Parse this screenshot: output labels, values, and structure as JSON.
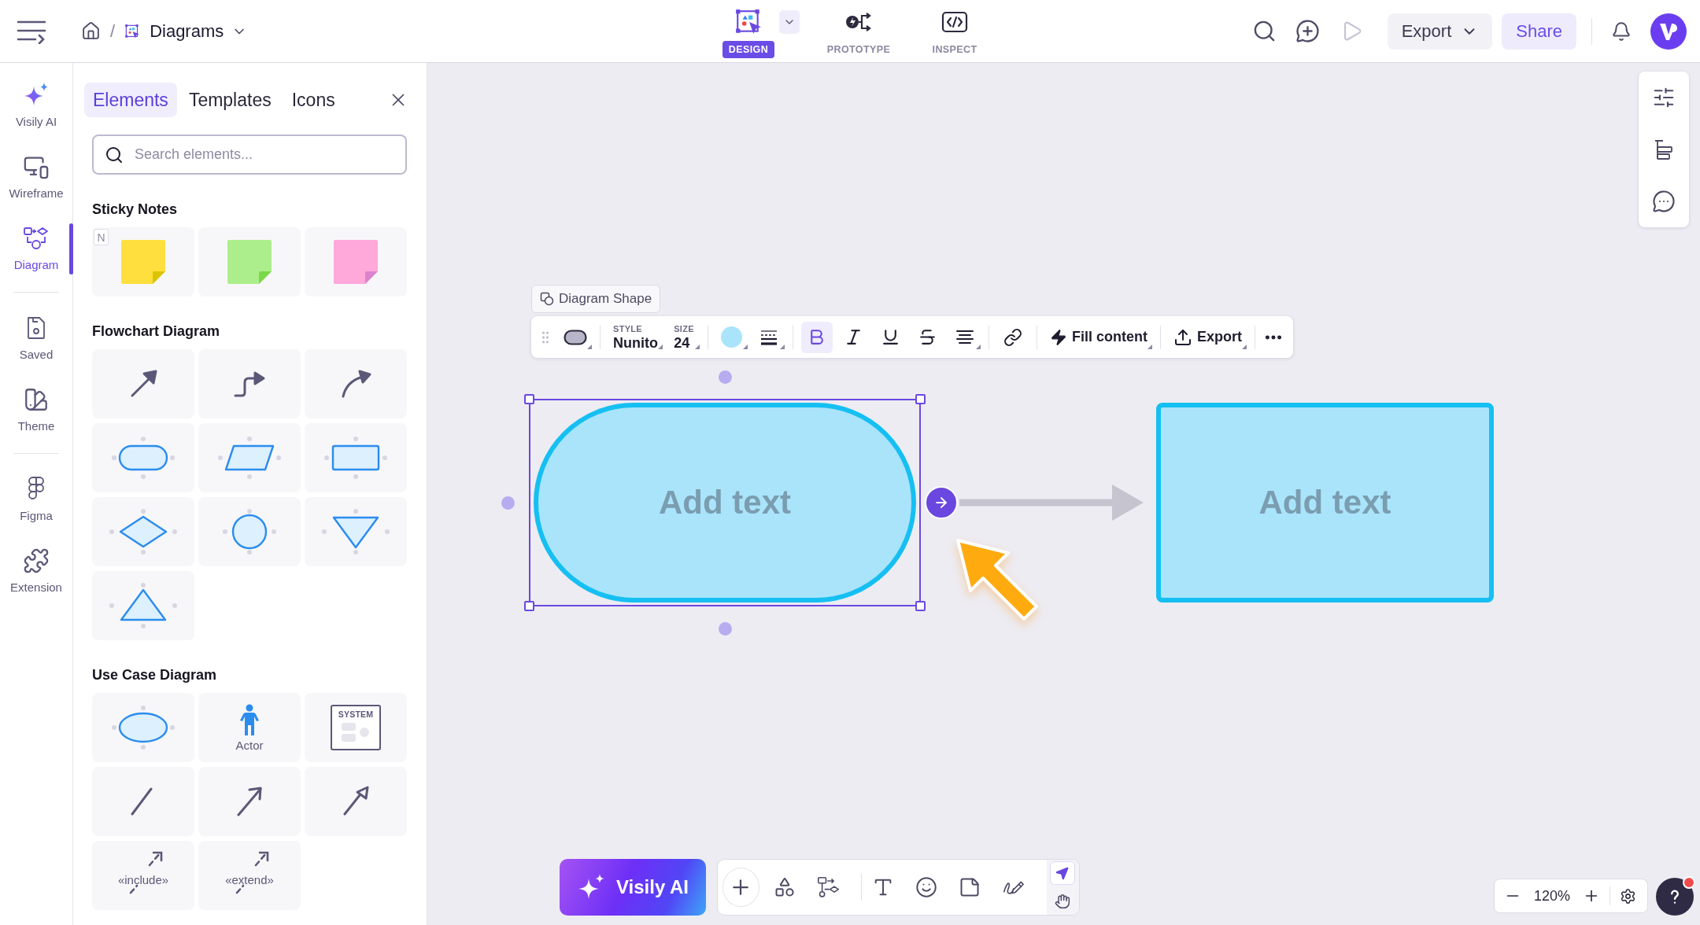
{
  "header": {
    "breadcrumb": {
      "separator": "/",
      "title": "Diagrams"
    },
    "modes": [
      {
        "kind": "design",
        "label": "DESIGN",
        "selected": true
      },
      {
        "kind": "prototype",
        "label": "PROTOTYPE",
        "selected": false
      },
      {
        "kind": "inspect",
        "label": "INSPECT",
        "selected": false
      }
    ],
    "actions": [
      {
        "kind": "search",
        "disabled": false
      },
      {
        "kind": "comment-add",
        "disabled": false
      },
      {
        "kind": "play",
        "disabled": true
      }
    ],
    "export_button": "Export",
    "share_button": "Share"
  },
  "rail": {
    "groups": [
      [
        {
          "kind": "ai",
          "label": "Visily AI",
          "selected": false
        },
        {
          "kind": "wireframe",
          "label": "Wireframe",
          "selected": false
        },
        {
          "kind": "diagram",
          "label": "Diagram",
          "selected": true
        }
      ],
      [
        {
          "kind": "saved",
          "label": "Saved",
          "selected": false
        },
        {
          "kind": "theme",
          "label": "Theme",
          "selected": false
        }
      ],
      [
        {
          "kind": "figma",
          "label": "Figma",
          "selected": false
        },
        {
          "kind": "extension",
          "label": "Extension",
          "selected": false
        }
      ]
    ]
  },
  "panel": {
    "tabs": [
      {
        "label": "Elements",
        "selected": true
      },
      {
        "label": "Templates",
        "selected": false
      },
      {
        "label": "Icons",
        "selected": false
      }
    ],
    "search": {
      "placeholder": "Search elements..."
    },
    "sections": [
      {
        "title": "Sticky Notes",
        "items": [
          {
            "kind": "sticky",
            "color": "#ffdf3e",
            "shortcut": "N"
          },
          {
            "kind": "sticky",
            "color": "#acee8b"
          },
          {
            "kind": "sticky",
            "color": "#ffa8da"
          }
        ]
      },
      {
        "title": "Flowchart Diagram",
        "items": [
          {
            "kind": "arrow"
          },
          {
            "kind": "elbow-arrow"
          },
          {
            "kind": "curved-arrow"
          },
          {
            "kind": "terminator"
          },
          {
            "kind": "parallelogram"
          },
          {
            "kind": "rectangle"
          },
          {
            "kind": "diamond"
          },
          {
            "kind": "circle"
          },
          {
            "kind": "triangle-down"
          },
          {
            "kind": "triangle-up"
          }
        ]
      },
      {
        "title": "Use Case Diagram",
        "items": [
          {
            "kind": "ellipse"
          },
          {
            "kind": "actor",
            "label": "Actor"
          },
          {
            "kind": "system",
            "label": "SYSTEM"
          },
          {
            "kind": "line"
          },
          {
            "kind": "open-arrow"
          },
          {
            "kind": "hollow-arrow"
          },
          {
            "kind": "dashed-arrow",
            "label": "«include»"
          },
          {
            "kind": "dashed-arrow",
            "label": "«extend»"
          }
        ]
      }
    ]
  },
  "canvas": {
    "selection_label": "Diagram Shape",
    "toolbar": {
      "style": {
        "label": "STYLE",
        "value": "Nunito"
      },
      "size": {
        "label": "SIZE",
        "value": "24"
      },
      "format": [
        {
          "kind": "bold",
          "selected": true
        },
        {
          "kind": "italic",
          "selected": false
        },
        {
          "kind": "underline",
          "selected": false
        },
        {
          "kind": "strikethrough",
          "selected": false
        }
      ],
      "fill_button": "Fill content",
      "export_button": "Export"
    },
    "shapes": [
      {
        "kind": "pill",
        "text": "Add text",
        "selected": true
      },
      {
        "kind": "rectangle",
        "text": "Add text",
        "selected": false
      }
    ],
    "side_tools": [
      {
        "kind": "properties"
      },
      {
        "kind": "layers"
      },
      {
        "kind": "comments"
      }
    ],
    "ai_button": "Visily AI",
    "tools": [
      [
        {
          "kind": "add"
        },
        {
          "kind": "shapes"
        },
        {
          "kind": "diagram"
        }
      ],
      [
        {
          "kind": "text"
        },
        {
          "kind": "emoji"
        },
        {
          "kind": "sticky"
        },
        {
          "kind": "draw"
        }
      ]
    ],
    "pointer_tools": [
      {
        "kind": "select",
        "selected": true
      },
      {
        "kind": "hand",
        "selected": false
      }
    ],
    "zoom": "120%",
    "help": {
      "notification": true
    }
  }
}
